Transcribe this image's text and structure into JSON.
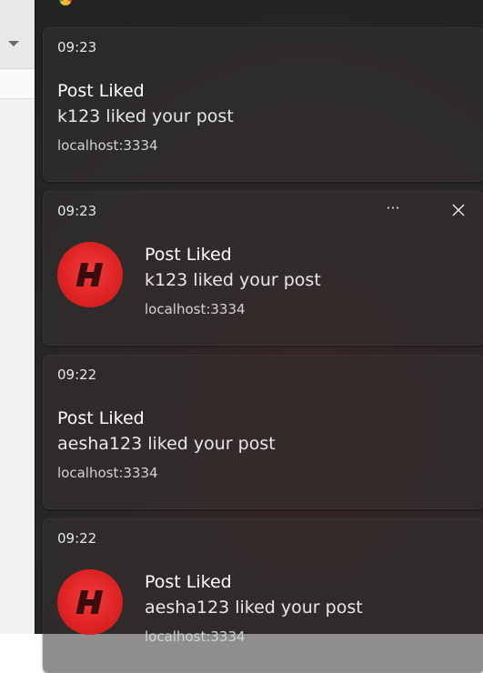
{
  "notifications": [
    {
      "time": "09:23",
      "title": "Post Liked",
      "message": "k123 liked your post",
      "source": "localhost:3334",
      "has_icon": false
    },
    {
      "time": "09:23",
      "title": "Post Liked",
      "message": "k123 liked your post",
      "source": "localhost:3334",
      "has_icon": true,
      "more_label": "···",
      "icon_name": "h-logo-icon"
    },
    {
      "time": "09:22",
      "title": "Post Liked",
      "message": "aesha123 liked your post",
      "source": "localhost:3334",
      "has_icon": false
    },
    {
      "time": "09:22",
      "title": "Post Liked",
      "message": "aesha123 liked your post",
      "source": "localhost:3334",
      "has_icon": true,
      "icon_name": "h-logo-icon"
    }
  ],
  "colors": {
    "logo_red": "#e02424",
    "panel_bg": "#262626"
  }
}
